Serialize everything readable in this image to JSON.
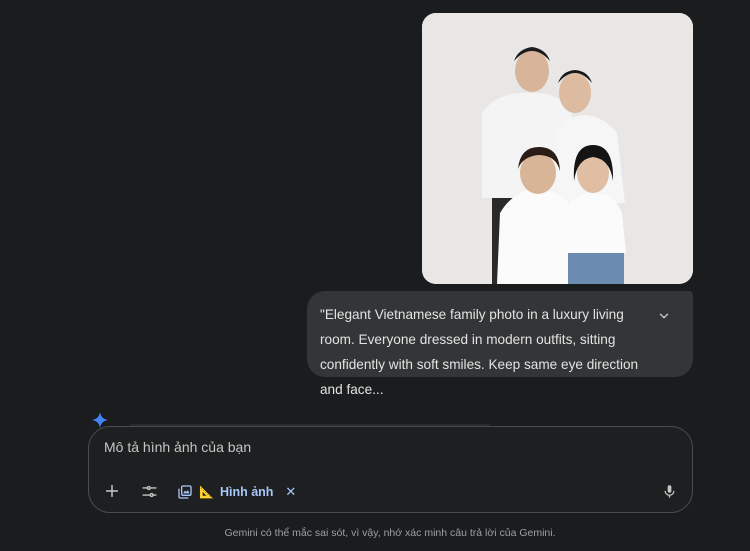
{
  "conversation": {
    "user_image": {
      "icon": "family-photo"
    },
    "user_prompt": {
      "text": "\"Elegant Vietnamese family photo in a luxury living room. Everyone dressed in modern outfits, sitting confidently with soft smiles. Keep same eye direction and face...",
      "expand_icon": "chevron-down-icon"
    }
  },
  "composer": {
    "placeholder": "Mô tả hình ảnh của bạn",
    "add_icon": "plus-icon",
    "tools_icon": "tune-icon",
    "tool_chip": {
      "icon": "image-gallery-icon",
      "emoji": "📐",
      "label": "Hình ảnh",
      "close_glyph": "✕"
    },
    "mic_icon": "mic-icon"
  },
  "footer": {
    "disclaimer": "Gemini có thể mắc sai sót, vì vậy, nhớ xác minh câu trả lời của Gemini."
  },
  "colors": {
    "background": "#1b1c1d",
    "bubble": "#333537",
    "accent": "#a8c7fa",
    "sparkle": "#4285f4"
  }
}
